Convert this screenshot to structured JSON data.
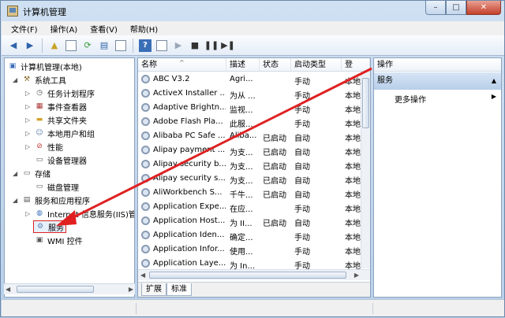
{
  "window": {
    "title": "计算机管理"
  },
  "menu": [
    "文件(F)",
    "操作(A)",
    "查看(V)",
    "帮助(H)"
  ],
  "tree": [
    {
      "label": "计算机管理(本地)",
      "icon": "computer-icon"
    },
    {
      "label": "系统工具",
      "icon": "tools-icon"
    },
    {
      "label": "任务计划程序",
      "icon": "clock-icon"
    },
    {
      "label": "事件查看器",
      "icon": "event-icon"
    },
    {
      "label": "共享文件夹",
      "icon": "folder-icon"
    },
    {
      "label": "本地用户和组",
      "icon": "users-icon"
    },
    {
      "label": "性能",
      "icon": "performance-icon"
    },
    {
      "label": "设备管理器",
      "icon": "device-icon"
    },
    {
      "label": "存储",
      "icon": "storage-icon"
    },
    {
      "label": "磁盘管理",
      "icon": "disk-icon"
    },
    {
      "label": "服务和应用程序",
      "icon": "services-apps-icon"
    },
    {
      "label": "Internet 信息服务(IIS)管",
      "icon": "iis-icon"
    },
    {
      "label": "服务",
      "icon": "services-icon"
    },
    {
      "label": "WMI 控件",
      "icon": "wmi-icon"
    }
  ],
  "columns": [
    "名称",
    "描述",
    "状态",
    "启动类型",
    "登"
  ],
  "services": [
    {
      "name": "ABC V3.2",
      "desc": "Agri...",
      "status": "",
      "startup": "手动",
      "logon": "本地"
    },
    {
      "name": "ActiveX Installer ...",
      "desc": "为从 ...",
      "status": "",
      "startup": "手动",
      "logon": "本地"
    },
    {
      "name": "Adaptive Brightn...",
      "desc": "监视...",
      "status": "",
      "startup": "手动",
      "logon": "本地"
    },
    {
      "name": "Adobe Flash Pla...",
      "desc": "此服...",
      "status": "",
      "startup": "手动",
      "logon": "本地"
    },
    {
      "name": "Alibaba PC Safe ...",
      "desc": "Aliba...",
      "status": "已启动",
      "startup": "自动",
      "logon": "本地"
    },
    {
      "name": "Alipay payment ...",
      "desc": "为支...",
      "status": "已启动",
      "startup": "自动",
      "logon": "本地"
    },
    {
      "name": "Alipay security b...",
      "desc": "为支...",
      "status": "已启动",
      "startup": "自动",
      "logon": "本地"
    },
    {
      "name": "Alipay security s...",
      "desc": "为支...",
      "status": "已启动",
      "startup": "自动",
      "logon": "本地"
    },
    {
      "name": "AliWorkbench S...",
      "desc": "千牛...",
      "status": "已启动",
      "startup": "自动",
      "logon": "本地"
    },
    {
      "name": "Application Expe...",
      "desc": "在应...",
      "status": "",
      "startup": "手动",
      "logon": "本地"
    },
    {
      "name": "Application Host...",
      "desc": "为 II...",
      "status": "已启动",
      "startup": "自动",
      "logon": "本地"
    },
    {
      "name": "Application Iden...",
      "desc": "确定...",
      "status": "",
      "startup": "手动",
      "logon": "本地"
    },
    {
      "name": "Application Infor...",
      "desc": "使用...",
      "status": "",
      "startup": "手动",
      "logon": "本地"
    },
    {
      "name": "Application Laye...",
      "desc": "为 In...",
      "status": "",
      "startup": "手动",
      "logon": "本地"
    }
  ],
  "tabs": [
    "扩展",
    "标准"
  ],
  "actions": {
    "header": "操作",
    "section": "服务",
    "more": "更多操作"
  },
  "accent_color": "#e02020"
}
